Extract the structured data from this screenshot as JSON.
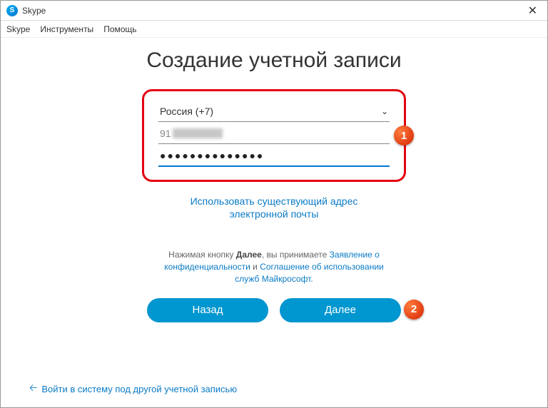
{
  "titlebar": {
    "app_name": "Skype"
  },
  "menubar": {
    "skype": "Skype",
    "tools": "Инструменты",
    "help": "Помощь"
  },
  "heading": "Создание учетной записи",
  "form": {
    "country": "Россия (+7)",
    "phone_prefix": "91",
    "password_dots": "●●●●●●●●●●●●●●"
  },
  "use_existing_email_line1": "Использовать существующий адрес",
  "use_existing_email_line2": "электронной почты",
  "tos": {
    "prefix": "Нажимая кнопку ",
    "bold": "Далее",
    "mid": ", вы принимаете ",
    "privacy": "Заявление о конфиденциальности",
    "and": " и ",
    "agreement": "Соглашение об использовании служб Майкрософт.",
    "priv_part1": "Заявление о",
    "priv_part2": "конфиденциальности",
    "agr_part1": "Соглашение об использовании",
    "agr_part2": "служб Майкрософт."
  },
  "buttons": {
    "back": "Назад",
    "next": "Далее"
  },
  "footer_link": "Войти в систему под другой учетной записью",
  "badges": {
    "one": "1",
    "two": "2"
  }
}
